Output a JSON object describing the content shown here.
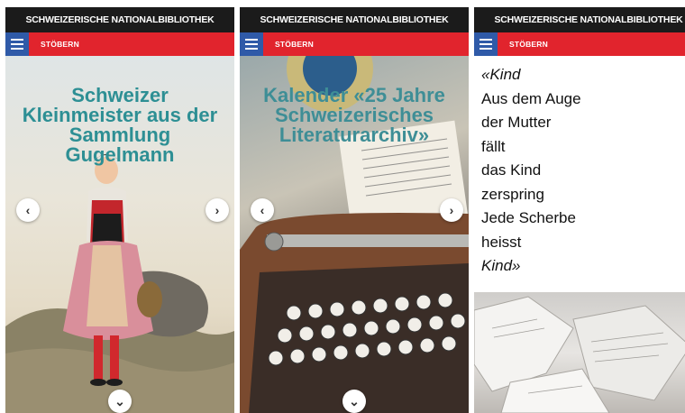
{
  "header": {
    "site_title": "SCHWEIZERISCHE NATIONALBIBLIOTHEK",
    "nav_label": "STÖBERN"
  },
  "screens": [
    {
      "title": "Schweizer Kleinmeister aus der Sammlung Gugelmann"
    },
    {
      "title": "Kalender «25 Jahre Schweizerisches Literaturarchiv»"
    },
    {
      "poem": [
        {
          "text": "«Kind",
          "italic": true
        },
        {
          "text": "Aus dem Auge",
          "italic": false
        },
        {
          "text": "der Mutter",
          "italic": false
        },
        {
          "text": "fällt",
          "italic": false
        },
        {
          "text": "das Kind",
          "italic": false
        },
        {
          "text": "zerspring",
          "italic": false
        },
        {
          "text": "Jede Scherbe",
          "italic": false
        },
        {
          "text": "heisst",
          "italic": false
        },
        {
          "text": "Kind»",
          "italic": true
        }
      ]
    }
  ],
  "controls": {
    "prev_icon": "‹",
    "next_icon": "›",
    "down_icon": "⌄"
  },
  "colors": {
    "topbar": "#1b1b1b",
    "navbar": "#e1242d",
    "menu_button": "#2f5aa8",
    "title_teal": "#2d8f94"
  }
}
